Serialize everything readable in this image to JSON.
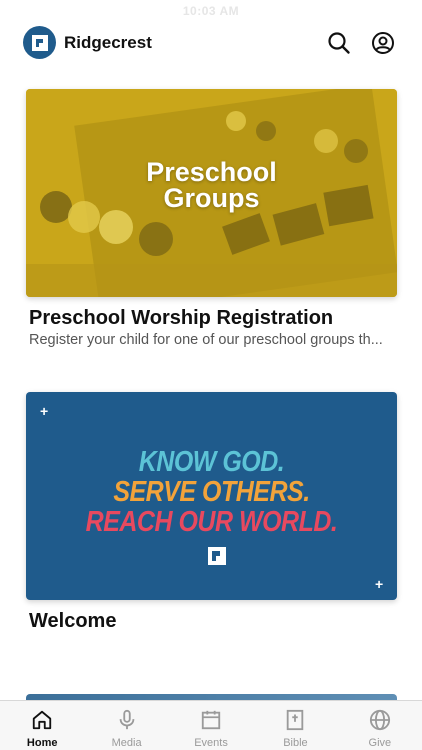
{
  "status_bar": {
    "time": "10:03 AM"
  },
  "header": {
    "app_name": "Ridgecrest",
    "logo_icon": "ridgecrest-logo-icon",
    "brand_color": "#1f5b8c"
  },
  "cards": [
    {
      "image_text_line1": "Preschool",
      "image_text_line2": "Groups",
      "title": "Preschool Worship Registration",
      "subtitle": "Register your child for one of our preschool groups th..."
    },
    {
      "image_line1": "KNOW GOD.",
      "image_line2": "SERVE OTHERS.",
      "image_line3": "REACH OUR WORLD.",
      "line1_color": "#5cc3d6",
      "line2_color": "#f2a33a",
      "line3_color": "#e8495f",
      "title": "Welcome"
    }
  ],
  "tabs": [
    {
      "label": "Home",
      "icon": "home-icon",
      "active": true
    },
    {
      "label": "Media",
      "icon": "microphone-icon",
      "active": false
    },
    {
      "label": "Events",
      "icon": "calendar-icon",
      "active": false
    },
    {
      "label": "Bible",
      "icon": "bible-icon",
      "active": false
    },
    {
      "label": "Give",
      "icon": "globe-icon",
      "active": false
    }
  ]
}
